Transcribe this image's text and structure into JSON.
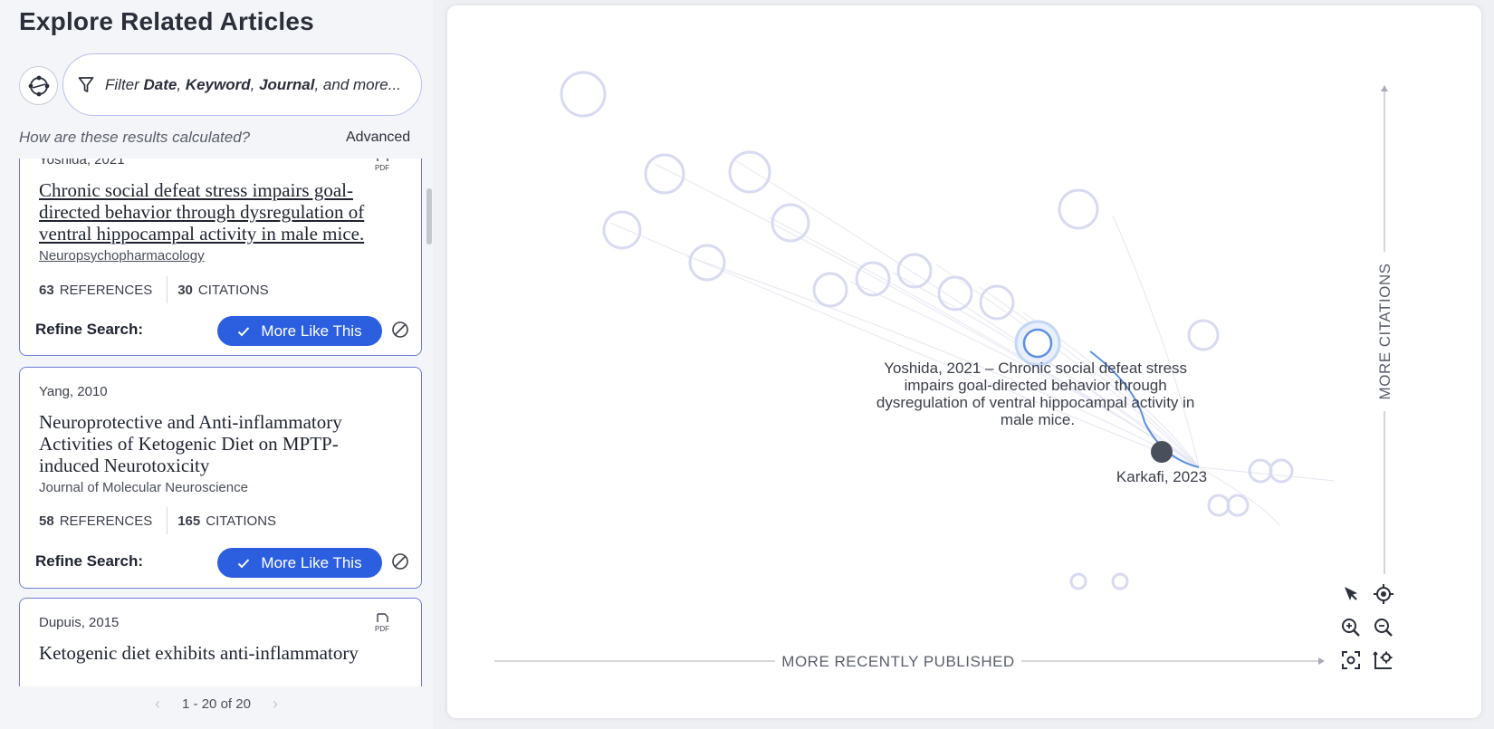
{
  "header": {
    "title": "Explore Related Articles"
  },
  "filter": {
    "prefix": "Filter ",
    "kw1": "Date",
    "sep1": ", ",
    "kw2": "Keyword",
    "sep2": ", ",
    "kw3": "Journal",
    "suffix": ", and more..."
  },
  "help_link": "How are these results calculated?",
  "advanced_link": "Advanced",
  "results": [
    {
      "author_year": "Yoshida, 2021",
      "pdf": "PDF",
      "title": "Chronic social defeat stress impairs goal-directed behavior through dysregulation of ventral hippocampal activity in male mice.",
      "journal": "Neuropsychopharmacology",
      "references_count": "63",
      "references_label": "REFERENCES",
      "citations_count": "30",
      "citations_label": "CITATIONS",
      "refine_label": "Refine Search:",
      "more_like_label": "More Like This"
    },
    {
      "author_year": "Yang, 2010",
      "title": "Neuroprotective and Anti-inflammatory Activities of Ketogenic Diet on MPTP-induced Neurotoxicity",
      "journal": "Journal of Molecular Neuroscience",
      "references_count": "58",
      "references_label": "REFERENCES",
      "citations_count": "165",
      "citations_label": "CITATIONS",
      "refine_label": "Refine Search:",
      "more_like_label": "More Like This"
    },
    {
      "author_year": "Dupuis, 2015",
      "pdf": "PDF",
      "title": "Ketogenic diet exhibits anti-inflammatory"
    }
  ],
  "pagination": {
    "range": "1 - 20 of 20"
  },
  "graph": {
    "selected_label_lines": [
      "Yoshida, 2021 – Chronic social defeat stress",
      "impairs goal-directed behavior through",
      "dysregulation of ventral hippocampal activity in",
      "male mice."
    ],
    "origin_label": "Karkafi, 2023",
    "x_axis_label": "MORE RECENTLY PUBLISHED",
    "y_axis_label": "MORE CITATIONS"
  },
  "tools": [
    "cursor-icon",
    "locate-icon",
    "zoom-in-icon",
    "zoom-out-icon",
    "fit-view-icon",
    "graph-settings-icon"
  ],
  "colors": {
    "accent": "#2c5fe0",
    "card_border": "#6c7bd8",
    "node_stroke": "#d8daf2",
    "selected_node": "#5b8fe0",
    "origin_node": "#4a4f5c"
  }
}
